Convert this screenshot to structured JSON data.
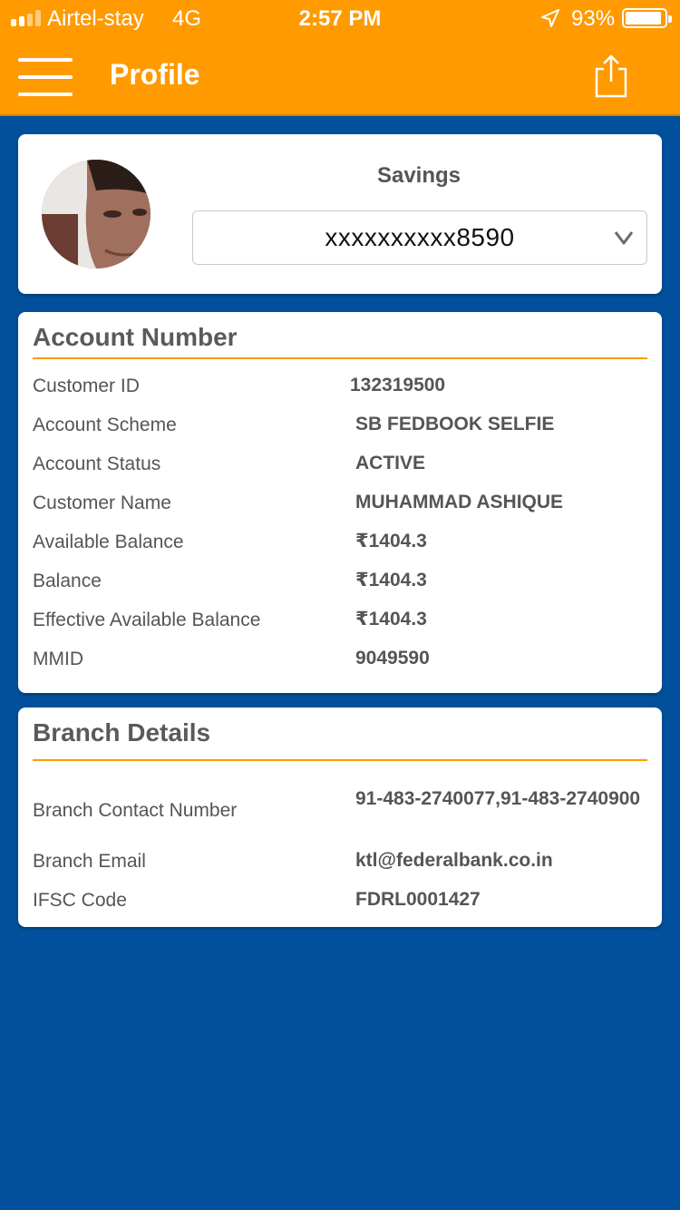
{
  "status_bar": {
    "carrier": "Airtel-stay",
    "network": "4G",
    "time": "2:57 PM",
    "battery": "93%",
    "battery_level": 0.93
  },
  "header": {
    "title": "Profile",
    "menu_icon": "hamburger-icon",
    "share_icon": "share-icon",
    "background": "#FF9A00"
  },
  "profile": {
    "account_type": "Savings",
    "selected_account": "xxxxxxxxxx8590"
  },
  "account_section": {
    "title": "Account Number",
    "rows": [
      {
        "label": "Customer ID",
        "value": "132319500"
      },
      {
        "label": "Account Scheme",
        "value": "SB FEDBOOK SELFIE"
      },
      {
        "label": "Account Status",
        "value": "ACTIVE"
      },
      {
        "label": "Customer Name",
        "value": "MUHAMMAD ASHIQUE"
      },
      {
        "label": "Available Balance",
        "value": "₹1404.3"
      },
      {
        "label": "Balance",
        "value": "₹1404.3"
      },
      {
        "label": "Effective Available Balance",
        "value": "₹1404.3"
      },
      {
        "label": "MMID",
        "value": "9049590"
      }
    ]
  },
  "branch_section": {
    "title": "Branch Details",
    "rows": [
      {
        "label": "Branch Contact Number",
        "value": "91-483-2740077,91-483-2740900"
      },
      {
        "label": "Branch Email",
        "value": "ktl@federalbank.co.in"
      },
      {
        "label": "IFSC Code",
        "value": "FDRL0001427"
      }
    ]
  },
  "colors": {
    "accent": "#FF9A00",
    "page_background": "#02509B"
  }
}
